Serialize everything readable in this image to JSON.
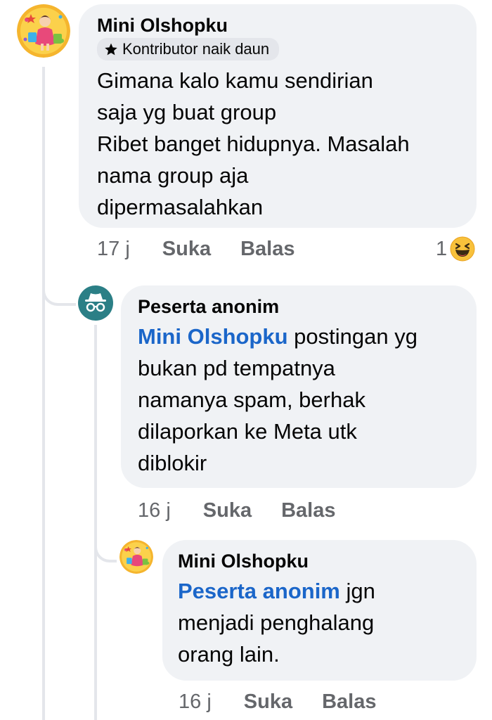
{
  "comments": [
    {
      "author": "Mini Olshopku",
      "badge": "Kontributor naik daun",
      "text": "Gimana kalo kamu sendirian\nsaja yg buat group\nRibet banget hidupnya. Masalah\nnama group aja\ndipermasalahkan",
      "time": "17 j",
      "like_label": "Suka",
      "reply_label": "Balas",
      "reaction_count": "1",
      "reaction_icon": "haha-emoji-icon"
    },
    {
      "author": "Peserta anonim",
      "mention": "Mini Olshopku",
      "text": " postingan yg\nbukan pd tempatnya\nnamanya spam, berhak\ndilaporkan ke Meta utk\ndiblokir",
      "time": "16 j",
      "like_label": "Suka",
      "reply_label": "Balas",
      "avatar_icon": "anonymous-incognito-icon"
    },
    {
      "author": "Mini Olshopku",
      "mention": "Peserta anonim",
      "text": " jgn\nmenjadi penghalang\norang lain.",
      "time": "16 j",
      "like_label": "Suka",
      "reply_label": "Balas"
    }
  ],
  "colors": {
    "bubble": "#f0f2f5",
    "mention": "#1b66c9",
    "meta_text": "#65676b",
    "thread_line": "#e4e6eb",
    "anon_avatar": "#2b7f86"
  }
}
